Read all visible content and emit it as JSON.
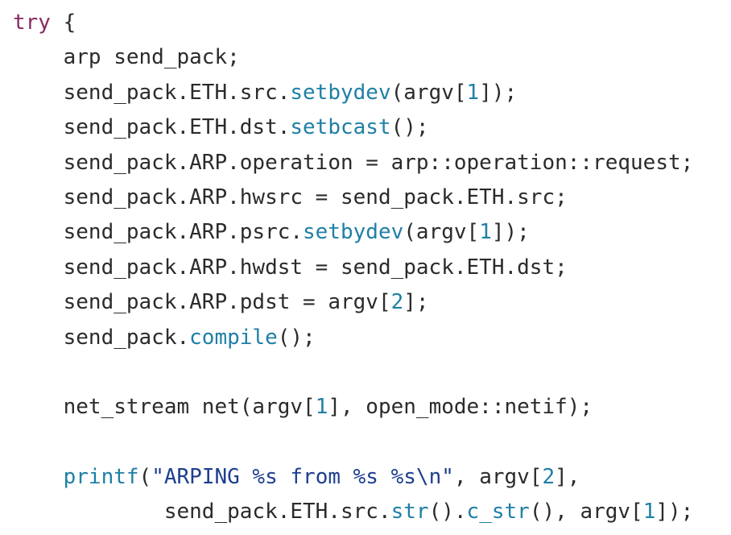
{
  "colors": {
    "background": "#ffffff",
    "text": "#2b2b2b",
    "keyword": "#8a2a63",
    "function": "#1f7fa6",
    "number": "#1f7fa6",
    "string": "#1e3f8f"
  },
  "code": {
    "lines": [
      [
        {
          "t": "try",
          "k": "kw"
        },
        {
          "t": " {",
          "k": "plain"
        }
      ],
      [
        {
          "t": "    arp send_pack;",
          "k": "plain"
        }
      ],
      [
        {
          "t": "    send_pack.ETH.src.",
          "k": "plain"
        },
        {
          "t": "setbydev",
          "k": "fn"
        },
        {
          "t": "(argv[",
          "k": "plain"
        },
        {
          "t": "1",
          "k": "num"
        },
        {
          "t": "]);",
          "k": "plain"
        }
      ],
      [
        {
          "t": "    send_pack.ETH.dst.",
          "k": "plain"
        },
        {
          "t": "setbcast",
          "k": "fn"
        },
        {
          "t": "();",
          "k": "plain"
        }
      ],
      [
        {
          "t": "    send_pack.ARP.operation = arp::operation::request;",
          "k": "plain"
        }
      ],
      [
        {
          "t": "    send_pack.ARP.hwsrc = send_pack.ETH.src;",
          "k": "plain"
        }
      ],
      [
        {
          "t": "    send_pack.ARP.psrc.",
          "k": "plain"
        },
        {
          "t": "setbydev",
          "k": "fn"
        },
        {
          "t": "(argv[",
          "k": "plain"
        },
        {
          "t": "1",
          "k": "num"
        },
        {
          "t": "]);",
          "k": "plain"
        }
      ],
      [
        {
          "t": "    send_pack.ARP.hwdst = send_pack.ETH.dst;",
          "k": "plain"
        }
      ],
      [
        {
          "t": "    send_pack.ARP.pdst = argv[",
          "k": "plain"
        },
        {
          "t": "2",
          "k": "num"
        },
        {
          "t": "];",
          "k": "plain"
        }
      ],
      [
        {
          "t": "    send_pack.",
          "k": "plain"
        },
        {
          "t": "compile",
          "k": "fn"
        },
        {
          "t": "();",
          "k": "plain"
        }
      ],
      [
        {
          "t": "",
          "k": "plain"
        }
      ],
      [
        {
          "t": "    net_stream net(argv[",
          "k": "plain"
        },
        {
          "t": "1",
          "k": "num"
        },
        {
          "t": "], open_mode::netif);",
          "k": "plain"
        }
      ],
      [
        {
          "t": "",
          "k": "plain"
        }
      ],
      [
        {
          "t": "    ",
          "k": "plain"
        },
        {
          "t": "printf",
          "k": "fn"
        },
        {
          "t": "(",
          "k": "plain"
        },
        {
          "t": "\"ARPING %s from %s %s\\n\"",
          "k": "str"
        },
        {
          "t": ", argv[",
          "k": "plain"
        },
        {
          "t": "2",
          "k": "num"
        },
        {
          "t": "],",
          "k": "plain"
        }
      ],
      [
        {
          "t": "            send_pack.ETH.src.",
          "k": "plain"
        },
        {
          "t": "str",
          "k": "fn"
        },
        {
          "t": "().",
          "k": "plain"
        },
        {
          "t": "c_str",
          "k": "fn"
        },
        {
          "t": "(), argv[",
          "k": "plain"
        },
        {
          "t": "1",
          "k": "num"
        },
        {
          "t": "]);",
          "k": "plain"
        }
      ]
    ]
  }
}
